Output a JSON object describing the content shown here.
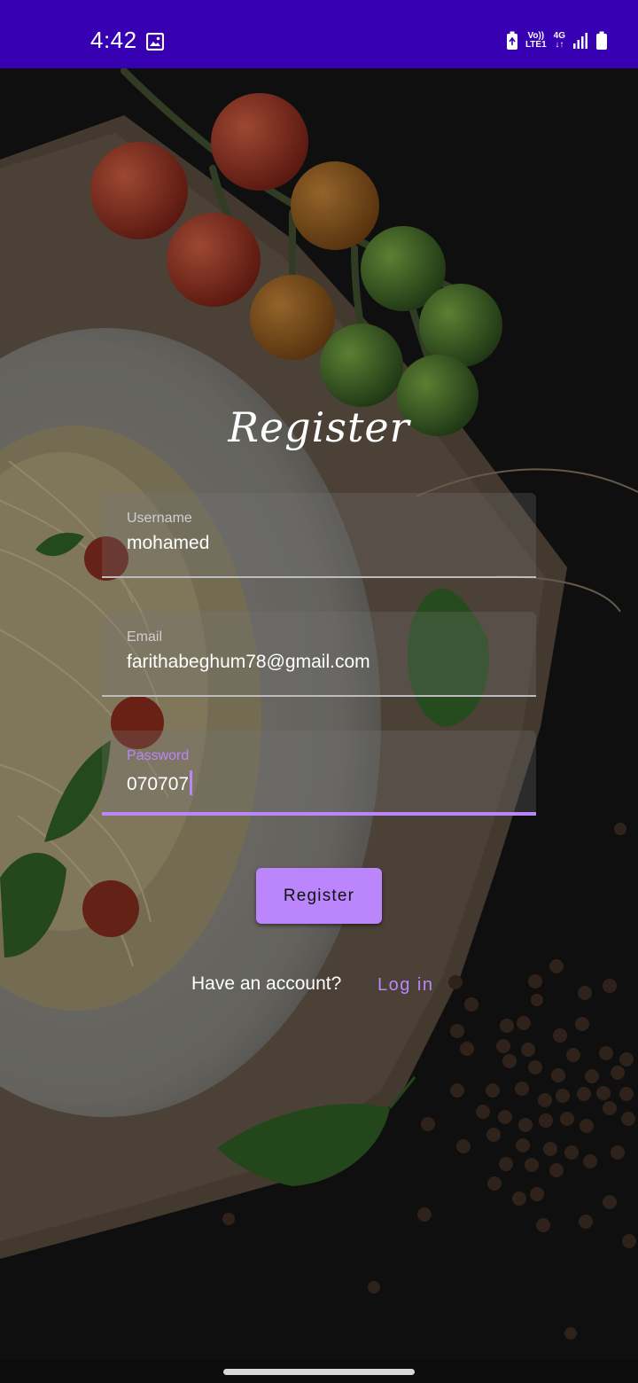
{
  "status_bar": {
    "time": "4:42",
    "volte": "Vo))",
    "lte": "LTE1",
    "network": "4G",
    "icons": [
      "gallery-icon",
      "battery-saver-icon",
      "signal-icon",
      "battery-icon"
    ]
  },
  "form": {
    "title": "Register",
    "username": {
      "label": "Username",
      "value": "mohamed"
    },
    "email": {
      "label": "Email",
      "value": "farithabeghum78@gmail.com"
    },
    "password": {
      "label": "Password",
      "value": "070707"
    },
    "submit_label": "Register",
    "have_account_text": "Have an account?",
    "login_link": "Log in"
  },
  "colors": {
    "status_bar": "#3700b3",
    "accent": "#bb86fc",
    "background": "#131313"
  }
}
